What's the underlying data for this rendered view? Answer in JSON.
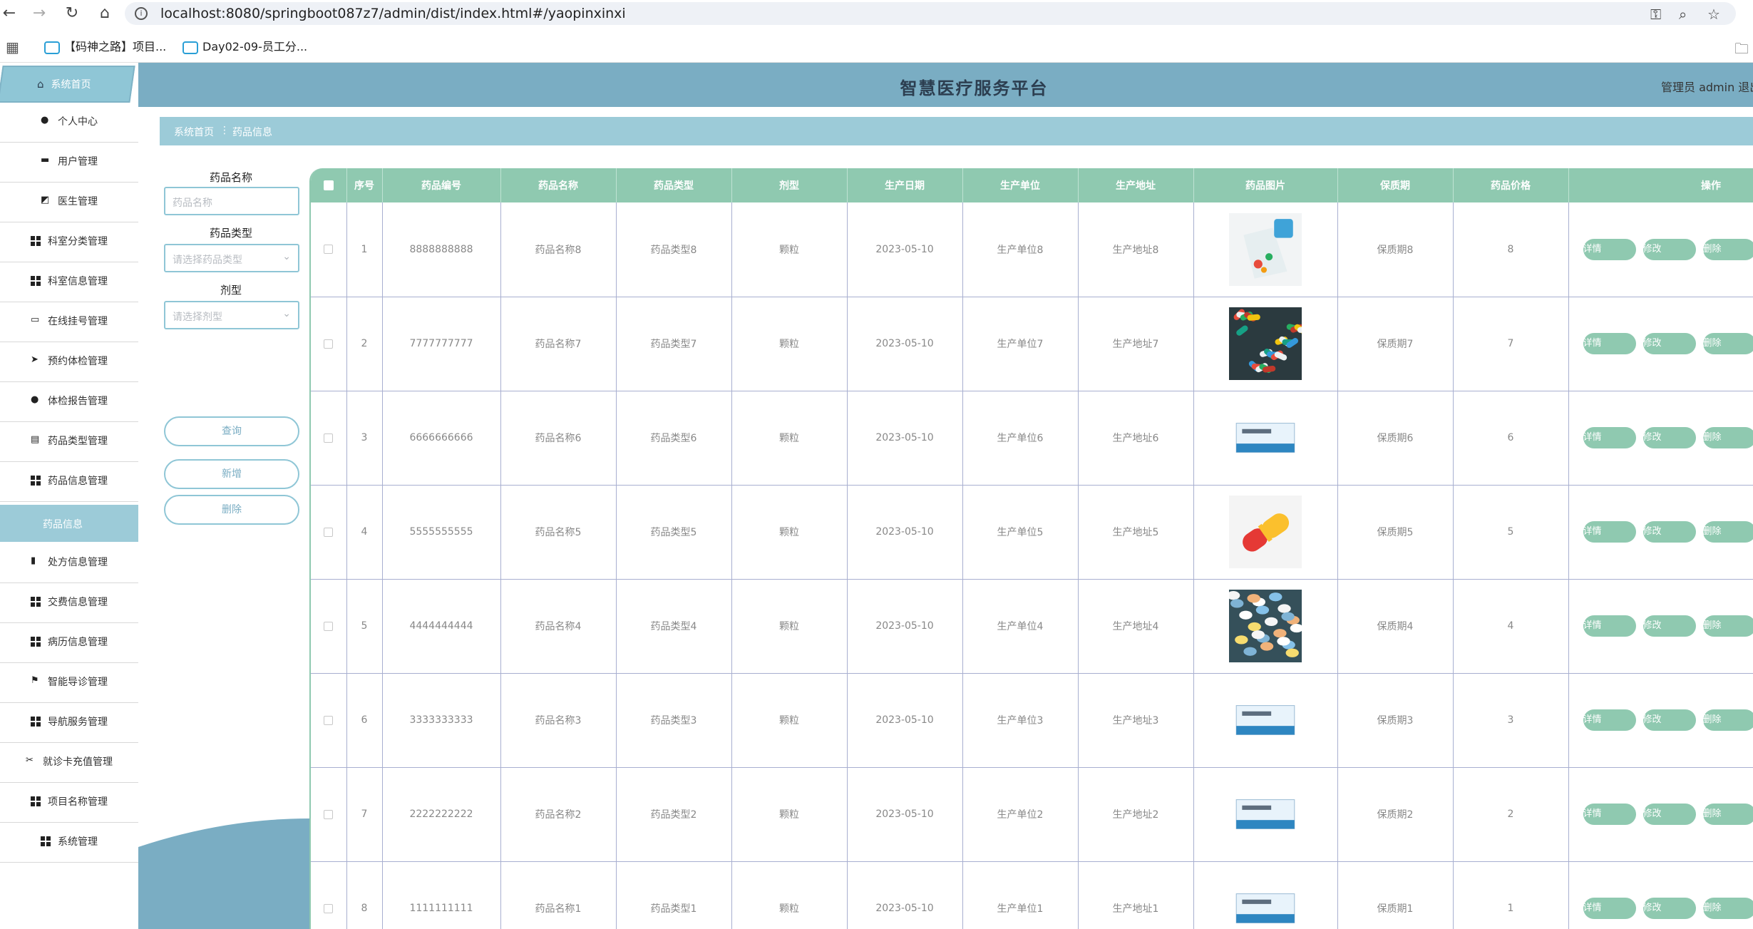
{
  "browser": {
    "url": "localhost:8080/springboot087z7/admin/dist/index.html#/yaopinxinxi",
    "bookmarks": [
      "【码神之路】项目...",
      "Day02-09-员工分..."
    ]
  },
  "header": {
    "title": "智慧医疗服务平台",
    "user": "管理员 admin  退出"
  },
  "sidebar": {
    "home": "系统首页",
    "items": [
      {
        "label": "个人中心",
        "icon": "person-icon"
      },
      {
        "label": "用户管理",
        "icon": "doc-icon"
      },
      {
        "label": "医生管理",
        "icon": "chart-icon"
      },
      {
        "label": "科室分类管理",
        "icon": "grid-icon"
      },
      {
        "label": "科室信息管理",
        "icon": "grid-icon"
      },
      {
        "label": "在线挂号管理",
        "icon": "briefcase-icon"
      },
      {
        "label": "预约体检管理",
        "icon": "send-icon"
      },
      {
        "label": "体检报告管理",
        "icon": "pin-icon"
      },
      {
        "label": "药品类型管理",
        "icon": "clipboard-icon"
      },
      {
        "label": "药品信息管理",
        "icon": "grid-icon"
      }
    ],
    "active_sub": "药品信息",
    "items_after": [
      {
        "label": "处方信息管理",
        "icon": "bars-icon"
      },
      {
        "label": "交费信息管理",
        "icon": "grid-icon"
      },
      {
        "label": "病历信息管理",
        "icon": "grid-icon"
      },
      {
        "label": "智能导诊管理",
        "icon": "flag-icon"
      },
      {
        "label": "导航服务管理",
        "icon": "grid-icon"
      },
      {
        "label": "就诊卡充值管理",
        "icon": "ticket-icon"
      },
      {
        "label": "项目名称管理",
        "icon": "grid-icon"
      },
      {
        "label": "系统管理",
        "icon": "grid-icon"
      }
    ]
  },
  "breadcrumb": {
    "home": "系统首页",
    "separator": "⋮",
    "current": "药品信息"
  },
  "search": {
    "name_label": "药品名称",
    "name_placeholder": "药品名称",
    "type_label": "药品类型",
    "type_placeholder": "请选择药品类型",
    "form_label": "剂型",
    "form_placeholder": "请选择剂型",
    "query_btn": "查询",
    "add_btn": "新增",
    "delete_btn": "删除"
  },
  "table": {
    "headers": [
      "序号",
      "药品编号",
      "药品名称",
      "药品类型",
      "剂型",
      "生产日期",
      "生产单位",
      "生产地址",
      "药品图片",
      "保质期",
      "药品价格",
      "操作"
    ],
    "actions": {
      "detail": "详情",
      "edit": "修改",
      "delete": "删除"
    },
    "rows": [
      {
        "idx": "1",
        "code": "8888888888",
        "name": "药品名称8",
        "type": "药品类型8",
        "form": "颗粒",
        "date": "2023-05-10",
        "unit": "生产单位8",
        "addr": "生产地址8",
        "image": "pill-bag-photo",
        "shelf": "保质期8",
        "price": "8"
      },
      {
        "idx": "2",
        "code": "7777777777",
        "name": "药品名称7",
        "type": "药品类型7",
        "form": "颗粒",
        "date": "2023-05-10",
        "unit": "生产单位7",
        "addr": "生产地址7",
        "image": "capsules-photo",
        "shelf": "保质期7",
        "price": "7"
      },
      {
        "idx": "3",
        "code": "6666666666",
        "name": "药品名称6",
        "type": "药品类型6",
        "form": "颗粒",
        "date": "2023-05-10",
        "unit": "生产单位6",
        "addr": "生产地址6",
        "image": "medicine-box-photo",
        "shelf": "保质期6",
        "price": "6"
      },
      {
        "idx": "4",
        "code": "5555555555",
        "name": "药品名称5",
        "type": "药品类型5",
        "form": "颗粒",
        "date": "2023-05-10",
        "unit": "生产单位5",
        "addr": "生产地址5",
        "image": "capsule-illustration",
        "shelf": "保质期5",
        "price": "5"
      },
      {
        "idx": "5",
        "code": "4444444444",
        "name": "药品名称4",
        "type": "药品类型4",
        "form": "颗粒",
        "date": "2023-05-10",
        "unit": "生产单位4",
        "addr": "生产地址4",
        "image": "pills-photo",
        "shelf": "保质期4",
        "price": "4"
      },
      {
        "idx": "6",
        "code": "3333333333",
        "name": "药品名称3",
        "type": "药品类型3",
        "form": "颗粒",
        "date": "2023-05-10",
        "unit": "生产单位3",
        "addr": "生产地址3",
        "image": "medicine-box-photo",
        "shelf": "保质期3",
        "price": "3"
      },
      {
        "idx": "7",
        "code": "2222222222",
        "name": "药品名称2",
        "type": "药品类型2",
        "form": "颗粒",
        "date": "2023-05-10",
        "unit": "生产单位2",
        "addr": "生产地址2",
        "image": "medicine-box-photo",
        "shelf": "保质期2",
        "price": "2"
      },
      {
        "idx": "8",
        "code": "1111111111",
        "name": "药品名称1",
        "type": "药品类型1",
        "form": "颗粒",
        "date": "2023-05-10",
        "unit": "生产单位1",
        "addr": "生产地址1",
        "image": "medicine-box-photo",
        "shelf": "保质期1",
        "price": "1"
      }
    ]
  },
  "colors": {
    "header": "#7aadc3",
    "accent": "#8fc6d6",
    "table_head": "#8fc9b0",
    "button": "#8fc9b0"
  }
}
